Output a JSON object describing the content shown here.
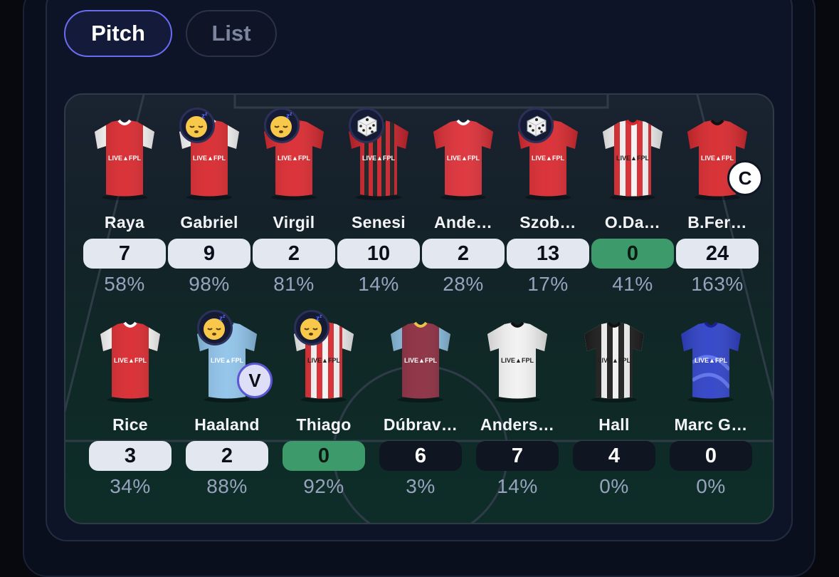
{
  "tabs": {
    "pitch": "Pitch",
    "list": "List",
    "active": "Pitch"
  },
  "colors": {
    "accent": "#6a6cf0",
    "played_pill": "#e3e7ef",
    "zero_pill": "#3d9a6b",
    "bench_pill": "#101522"
  },
  "starters": [
    {
      "name": "Raya",
      "points": "7",
      "ownership": "58%",
      "pill": "light",
      "icon": null,
      "role": null,
      "kit": "arsenal"
    },
    {
      "name": "Gabriel",
      "points": "9",
      "ownership": "98%",
      "pill": "light",
      "icon": "sleeping-face-icon",
      "role": null,
      "kit": "arsenal"
    },
    {
      "name": "Virgil",
      "points": "2",
      "ownership": "81%",
      "pill": "light",
      "icon": "sleeping-face-icon",
      "role": null,
      "kit": "liverpool"
    },
    {
      "name": "Senesi",
      "points": "10",
      "ownership": "14%",
      "pill": "light",
      "icon": "dice-icon",
      "role": null,
      "kit": "bournemouth"
    },
    {
      "name": "Ande…",
      "points": "2",
      "ownership": "28%",
      "pill": "light",
      "icon": null,
      "role": null,
      "kit": "forest"
    },
    {
      "name": "Szob…",
      "points": "13",
      "ownership": "17%",
      "pill": "light",
      "icon": "dice-icon",
      "role": null,
      "kit": "liverpool"
    },
    {
      "name": "O.Da…",
      "points": "0",
      "ownership": "41%",
      "pill": "green",
      "icon": null,
      "role": null,
      "kit": "brentford"
    },
    {
      "name": "B.Fer…",
      "points": "24",
      "ownership": "163%",
      "pill": "light",
      "icon": null,
      "role": "C",
      "kit": "manutd"
    }
  ],
  "second_row": [
    {
      "name": "Rice",
      "points": "3",
      "ownership": "34%",
      "pill": "light",
      "icon": null,
      "role": null,
      "kit": "arsenal"
    },
    {
      "name": "Haaland",
      "points": "2",
      "ownership": "88%",
      "pill": "light",
      "icon": "sleeping-face-icon",
      "role": "V",
      "kit": "mancity"
    },
    {
      "name": "Thiago",
      "points": "0",
      "ownership": "92%",
      "pill": "green",
      "icon": "sleeping-face-icon",
      "role": null,
      "kit": "brentford"
    },
    {
      "name": "Dúbrav…",
      "points": "6",
      "ownership": "3%",
      "pill": "dark",
      "icon": null,
      "role": null,
      "kit": "burnley"
    },
    {
      "name": "Anders…",
      "points": "7",
      "ownership": "14%",
      "pill": "dark",
      "icon": null,
      "role": null,
      "kit": "fulham"
    },
    {
      "name": "Hall",
      "points": "4",
      "ownership": "0%",
      "pill": "dark",
      "icon": null,
      "role": null,
      "kit": "newcastle"
    },
    {
      "name": "Marc G…",
      "points": "0",
      "ownership": "0%",
      "pill": "dark",
      "icon": null,
      "role": null,
      "kit": "everton"
    }
  ],
  "shirt_sponsor": "LIVE FPL"
}
